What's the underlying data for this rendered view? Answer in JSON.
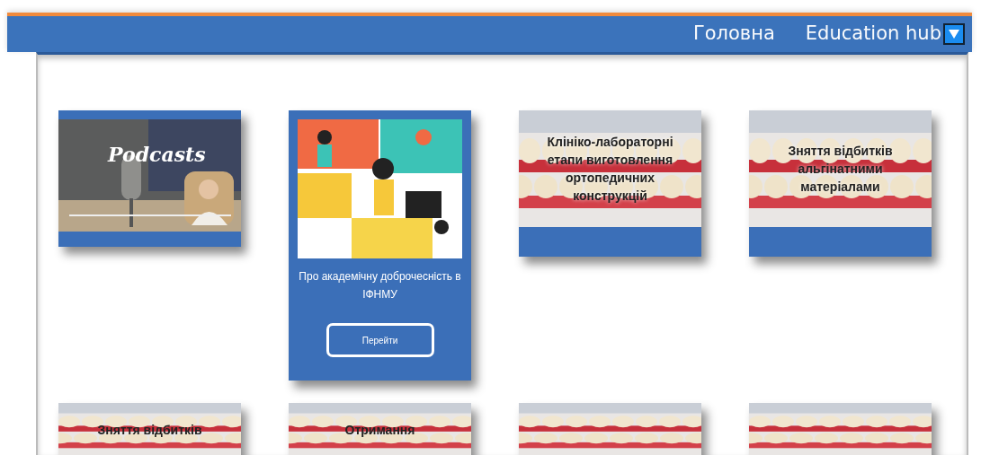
{
  "nav": {
    "items": [
      {
        "label": "Головна"
      },
      {
        "label": "Education hub"
      }
    ]
  },
  "cards": [
    {
      "kind": "podcast",
      "title": "Podcasts"
    },
    {
      "kind": "feature",
      "title": "Про академічну доброчесність в ІФНМУ",
      "button": "Перейти"
    },
    {
      "kind": "topic",
      "title": "Клініко-лабораторні етапи виготовлення ортопедичних конструкцій"
    },
    {
      "kind": "topic",
      "title": "Зняття відбитків альгінатними матеріалами"
    },
    {
      "kind": "topic",
      "title": "Зняття відбитків"
    },
    {
      "kind": "topic",
      "title": "Отримання"
    },
    {
      "kind": "topic"
    },
    {
      "kind": "topic"
    }
  ]
}
